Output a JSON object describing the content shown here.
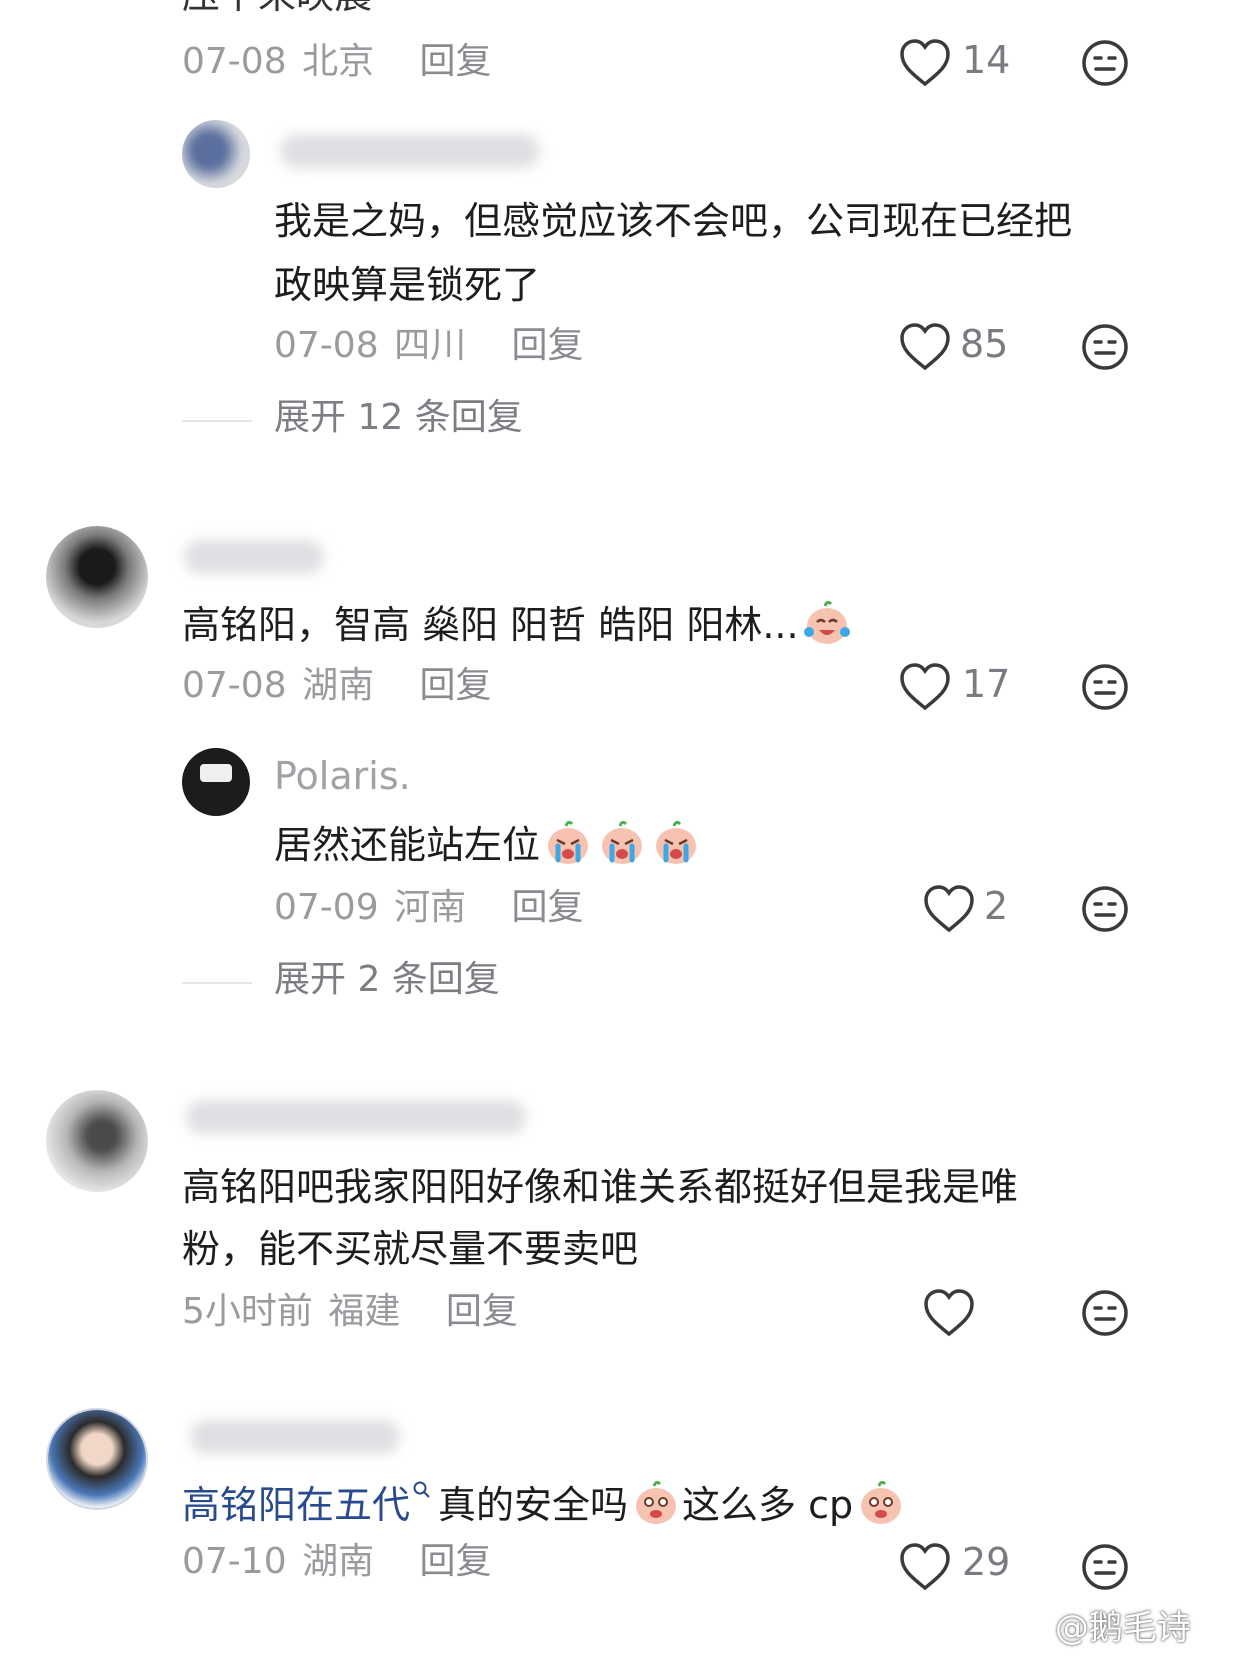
{
  "c0": {
    "partial_text": "压下来映晨",
    "date": "07-08",
    "location": "北京",
    "reply": "回复",
    "likes": "14"
  },
  "r1": {
    "text_line1": "我是之妈，但感觉应该不会吧，公司现在已经把",
    "text_line2": "政映算是锁死了",
    "date": "07-08",
    "location": "四川",
    "reply": "回复",
    "likes": "85",
    "expand": "展开 12 条回复"
  },
  "c2": {
    "text": "高铭阳，智高 燊阳 阳哲 皓阳 阳林...",
    "date": "07-08",
    "location": "湖南",
    "reply": "回复",
    "likes": "17"
  },
  "r2": {
    "username": "Polaris.",
    "text": "居然还能站左位",
    "date": "07-09",
    "location": "河南",
    "reply": "回复",
    "likes": "2",
    "expand": "展开 2 条回复"
  },
  "c3": {
    "text_line1": "高铭阳吧我家阳阳好像和谁关系都挺好但是我是唯",
    "text_line2": "粉，能不买就尽量不要卖吧",
    "date": "5小时前",
    "location": "福建",
    "reply": "回复",
    "likes": ""
  },
  "c4": {
    "link_text": "高铭阳在五代",
    "text_mid": "真的安全吗",
    "text_end": "这么多 cp",
    "date": "07-10",
    "location": "湖南",
    "reply": "回复",
    "likes": "29"
  },
  "watermark": "@鹅毛诗",
  "colors": {
    "meta": "#9a9a9f",
    "link": "#2a4a8f",
    "text": "#1d1d1f"
  }
}
